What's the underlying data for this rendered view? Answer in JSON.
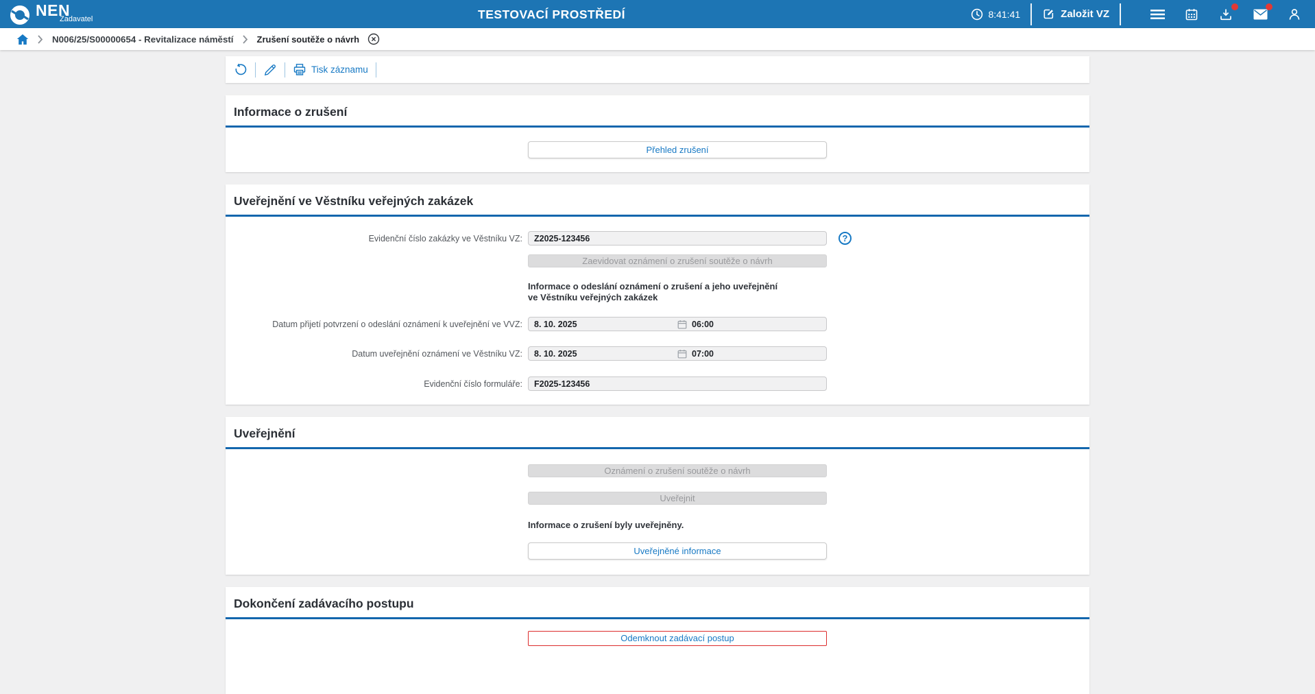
{
  "colors": {
    "header_bg": "#1d75b4",
    "accent_blue": "#1779c4",
    "section_underline": "#1266ad",
    "danger_red": "#dc2b2b",
    "badge_red": "#e23935"
  },
  "header": {
    "logo_text": "NEN",
    "logo_subtitle": "Zadavatel",
    "environment_title": "TESTOVACÍ PROSTŘEDÍ",
    "time": "8:41:41",
    "create_button_label": "Založit VZ",
    "tray_icons": [
      "clock-icon",
      "edit-square-icon",
      "menu-icon",
      "calendar-icon",
      "downloads-icon",
      "messages-icon",
      "user-icon"
    ]
  },
  "breadcrumb": {
    "items": [
      {
        "label": "N006/25/S00000654 - Revitalizace náměstí"
      },
      {
        "label": "Zrušení soutěže o návrh"
      }
    ]
  },
  "toolbar": {
    "print_label": "Tisk záznamu"
  },
  "sections": {
    "cancellation_info": {
      "title": "Informace o zrušení",
      "overview_button": "Přehled zrušení"
    },
    "vvz_publication": {
      "title": "Uveřejnění ve Věstníku veřejných zakázek",
      "journal_number": {
        "label": "Evidenční číslo zakázky ve Věstníku VZ:",
        "value": "Z2025-123456"
      },
      "help_icon_glyph": "?",
      "register_button": "Zaevidovat oznámení o zrušení soutěže o návrh",
      "note": "Informace o odeslání oznámení o zrušení a jeho uveřejnění\nve Věstníku veřejných zakázek",
      "confirmation_date": {
        "label": "Datum přijetí potvrzení o odeslání oznámení k uveřejnění ve VVZ:",
        "date": "8. 10. 2025",
        "time": "06:00"
      },
      "publication_date": {
        "label": "Datum uveřejnění oznámení ve Věstníku VZ:",
        "date": "8. 10. 2025",
        "time": "07:00"
      },
      "form_number": {
        "label": "Evidenční číslo formuláře:",
        "value": "F2025-123456"
      }
    },
    "publication": {
      "title": "Uveřejnění",
      "notice_button": "Oznámení o zrušení soutěže o návrh",
      "publish_button": "Uveřejnit",
      "status_text": "Informace o zrušení byly uveřejněny.",
      "published_info_button": "Uveřejněné informace"
    },
    "completion": {
      "title": "Dokončení zadávacího postupu",
      "unlock_button": "Odemknout zadávací postup"
    }
  }
}
